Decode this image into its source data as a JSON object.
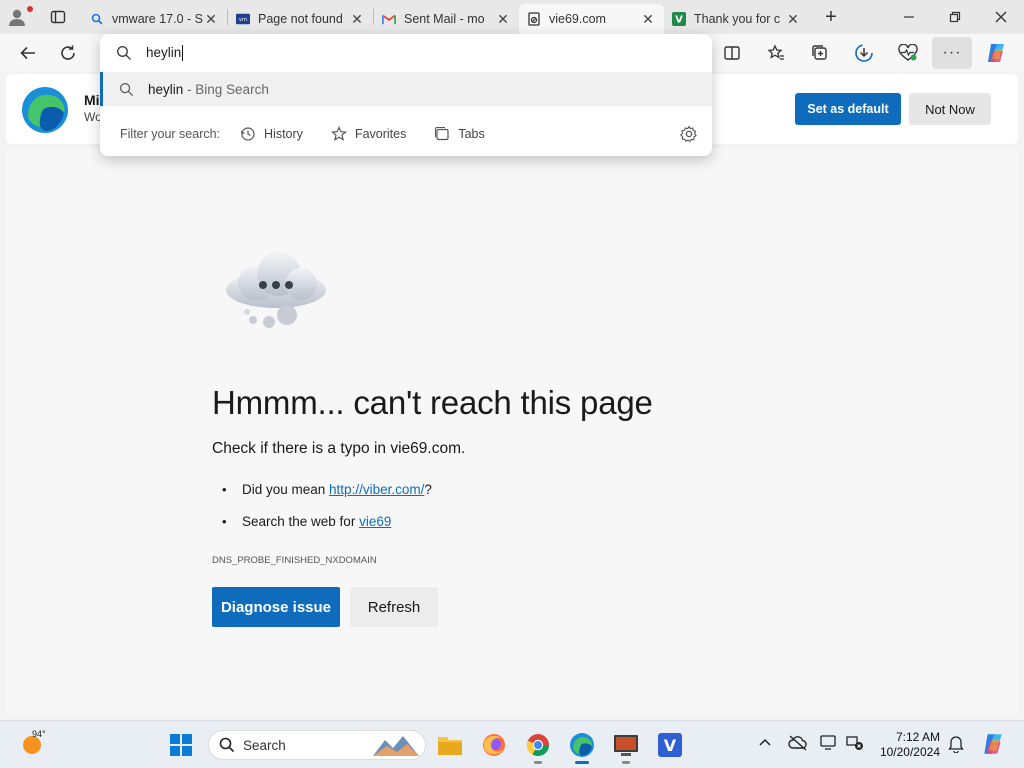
{
  "tabs": [
    {
      "title": "vmware 17.0 - S",
      "favicon": "search-icon",
      "active": false
    },
    {
      "title": "Page not found",
      "favicon": "vmware-icon",
      "active": false
    },
    {
      "title": "Sent Mail - mo",
      "favicon": "gmail-icon",
      "active": false
    },
    {
      "title": "vie69.com",
      "favicon": "error-page-icon",
      "active": true
    },
    {
      "title": "Thank you for c",
      "favicon": "green-v-icon",
      "active": false
    }
  ],
  "omnibox": {
    "value": "heylin",
    "suggestion_query": "heylin",
    "suggestion_source": " - Bing Search",
    "filter_label": "Filter your search:",
    "filters": [
      "History",
      "Favorites",
      "Tabs"
    ]
  },
  "banner": {
    "title": "Mi",
    "subtitle": "Wo",
    "set_default_label": "Set as default",
    "not_now_label": "Not Now"
  },
  "error": {
    "title": "Hmmm... can't reach this page",
    "subtitle": "Check if there is a typo in vie69.com.",
    "suggestion1_prefix": "Did you mean ",
    "suggestion1_link": "http://viber.com/",
    "suggestion1_suffix": "?",
    "suggestion2_prefix": "Search the web for ",
    "suggestion2_link": "vie69",
    "code": "DNS_PROBE_FINISHED_NXDOMAIN",
    "diagnose_label": "Diagnose issue",
    "refresh_label": "Refresh"
  },
  "taskbar": {
    "weather_temp": "94°",
    "search_label": "Search",
    "time": "7:12 AM",
    "date": "10/20/2024"
  },
  "colors": {
    "accent": "#0f6cbd",
    "link": "#0f6cbd"
  }
}
